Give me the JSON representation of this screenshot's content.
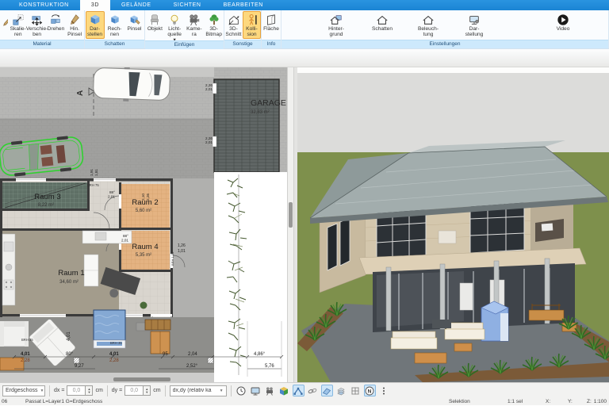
{
  "tabs": {
    "items": [
      "KONSTRUKTION",
      "3D",
      "GELÄNDE",
      "SICHTEN",
      "BEARBEITEN"
    ],
    "active": "3D"
  },
  "ribbon": {
    "groups": [
      {
        "name": "Material",
        "buttons": [
          {
            "label": ""
          },
          {
            "label": "Skalie-\nren"
          },
          {
            "label": "Verschie-\nben"
          },
          {
            "label": "Drehen"
          },
          {
            "label": "Hin.\nPinsel"
          }
        ]
      },
      {
        "name": "Schatten",
        "buttons": [
          {
            "label": "Dar-\nstellen"
          },
          {
            "label": "Rech-\nnen"
          },
          {
            "label": "Pinsel"
          }
        ]
      },
      {
        "name": "Einfügen",
        "buttons": [
          {
            "label": "Objekt"
          },
          {
            "label": "Licht-\nquelle ▾"
          },
          {
            "label": "Kame-\nra"
          },
          {
            "label": "3D-\nBitmap"
          }
        ]
      },
      {
        "name": "Sonstige",
        "buttons": [
          {
            "label": "3D-\nSchnitt"
          },
          {
            "label": "Kolli-\nsion"
          }
        ]
      },
      {
        "name": "Info",
        "buttons": [
          {
            "label": "Fläche"
          }
        ]
      },
      {
        "name": "Einstellungen",
        "buttons": [
          {
            "label": "Hinter-\ngrund"
          },
          {
            "label": "Schatten"
          },
          {
            "label": "Beleuch-\ntung"
          },
          {
            "label": "Dar-\nstellung"
          },
          {
            "label": "Video"
          }
        ]
      }
    ]
  },
  "plan": {
    "garage": {
      "name": "GARAGE",
      "area": "32,83 m²"
    },
    "rooms": [
      {
        "name": "Raum 1",
        "area": "34,60 m²"
      },
      {
        "name": "Raum 2",
        "area": "5,60 m²"
      },
      {
        "name": "Raum 3",
        "area": "8,22 m²"
      },
      {
        "name": "Raum 4",
        "area": "5,35 m²"
      }
    ],
    "section_marker": "A",
    "dims": {
      "m1": "4,01",
      "m2": "2,28",
      "m3": "80°",
      "m4": "4,01",
      "m5": "2,28",
      "m6": "95",
      "m7": "2,04",
      "m8": "9,27",
      "m9": "2,52°",
      "m10": "4,86°",
      "m11": "5,76",
      "v_left": "4,01",
      "r2a": "88°",
      "r2b": "2,01",
      "r4a": "88°",
      "r4b": "2,01",
      "v2a": "2,10",
      "v2b": "2,26",
      "s1": "1,91",
      "s2": "1,81",
      "ra": "1,26",
      "rb": "1,01",
      "g1a": "2,26",
      "g1b": "2,01",
      "g2a": "2,26",
      "g2b": "2,01",
      "brh75": "BRH 75",
      "brh35a": "BRH 35",
      "brh35b": "BRH 35",
      "brh150": "BRH 1,50"
    }
  },
  "toolbar": {
    "floor_select": "Erdgeschoss",
    "dx_label": "dx =",
    "dx_value": "0,0",
    "dx_unit": "cm",
    "dy_label": "dy =",
    "dy_value": "0,0",
    "dy_unit": "cm",
    "mode_select": "dx,dy (relativ ka"
  },
  "statusline": {
    "left_partial": "06",
    "context": "Passat L=Layer1 G=Erdgeschoss",
    "selection": "Selektion",
    "scale_sel": "1:1 sel",
    "x_label": "X:",
    "y_label": "Y:",
    "z_label": "Z:",
    "zoom": "1:100"
  },
  "colors": {
    "accent_blue": "#1a84d4",
    "active_button": "#fdd87e",
    "selection_green": "#2fd12f",
    "lawn_green": "#7e904c"
  }
}
